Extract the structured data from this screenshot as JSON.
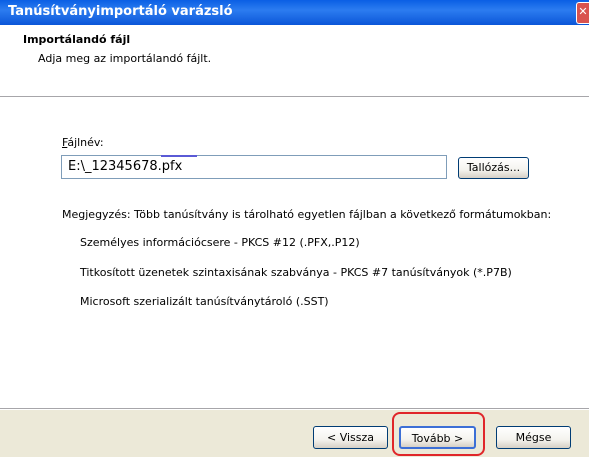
{
  "window": {
    "title": "Tanúsítványimportáló varázsló",
    "close_glyph": "✕"
  },
  "header": {
    "title": "Importálandó fájl",
    "subtitle": "Adja meg az importálandó fájlt."
  },
  "filename": {
    "label_prefix": "",
    "label_access": "F",
    "label_rest": "ájlnév:",
    "value": "E:\\_12345678.pfx",
    "browse_button": "Tallózás..."
  },
  "note": "Megjegyzés: Több tanúsítvány is tárolható egyetlen fájlban a következő formátumokban:",
  "formats": [
    "Személyes információcsere - PKCS #12 (.PFX,.P12)",
    "Titkosított üzenetek szintaxisának szabványa  - PKCS #7 tanúsítványok (*.P7B)",
    "Microsoft szerializált tanúsítványtároló (.SST)"
  ],
  "buttons": {
    "back": "< Vissza",
    "next": "Tovább >",
    "cancel": "Mégse"
  },
  "colors": {
    "title_bar": "#0b56d8",
    "highlight": "#e0262a",
    "dialog_bg": "#ECE9D8"
  }
}
